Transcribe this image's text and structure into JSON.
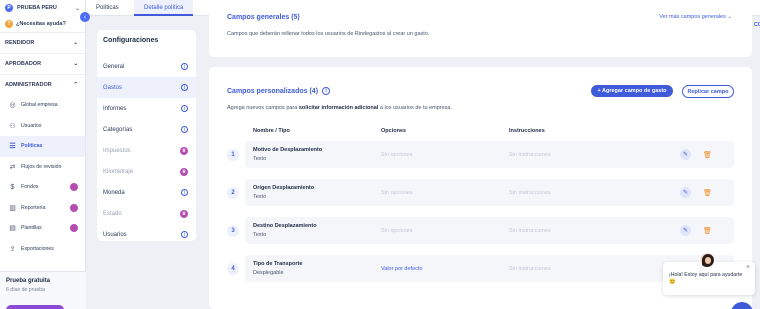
{
  "sidebar": {
    "org_name": "PRUEBA PERU",
    "org_initial": "P",
    "help_label": "¿Necesitas ayuda?",
    "sections": {
      "rendidor": "RENDIDOR",
      "aprobador": "APROBADOR",
      "administrador": "ADMINISTRADOR"
    },
    "items": [
      {
        "label": "Global empresa",
        "icon": "globe-icon"
      },
      {
        "label": "Usuarios",
        "icon": "users-icon"
      },
      {
        "label": "Políticas",
        "icon": "policy-icon"
      },
      {
        "label": "Flujos de revisión",
        "icon": "flow-icon"
      },
      {
        "label": "Fondos",
        "icon": "money-icon"
      },
      {
        "label": "Reportería",
        "icon": "chart-icon"
      },
      {
        "label": "Plantillas",
        "icon": "template-icon"
      },
      {
        "label": "Exportaciones",
        "icon": "export-icon"
      }
    ],
    "trial_title": "Prueba gratuita",
    "trial_days": "6 días de prueba"
  },
  "topbar": {
    "tabs": [
      "Políticas",
      "Detalle política"
    ]
  },
  "config": {
    "title": "Configuraciones",
    "items": [
      {
        "label": "General"
      },
      {
        "label": "Gastos"
      },
      {
        "label": "Informes"
      },
      {
        "label": "Categorías"
      },
      {
        "label": "Impuestos"
      },
      {
        "label": "Kilometraje"
      },
      {
        "label": "Moneda"
      },
      {
        "label": "Estado"
      },
      {
        "label": "Usuarios"
      }
    ]
  },
  "general_fields": {
    "title": "Campos generales (5)",
    "description": "Campos que deberán rellenar todos los usuarios de Rindegastos al crear un gasto.",
    "more_label": "Ver más campos generales"
  },
  "custom_fields": {
    "title": "Campos personalizados (4)",
    "desc_pre": "Agrega nuevos campos para ",
    "desc_bold": "solicitar información adicional",
    "desc_post": " a los usuarios de tu empresa.",
    "add_button": "+ Agregar campo de gasto",
    "replicate_button": "Replicar campo",
    "columns": {
      "name": "Nombre / Tipo",
      "options": "Opciones",
      "instructions": "Instrucciones"
    },
    "rows": [
      {
        "num": "1",
        "name": "Motivo de Desplazamiento",
        "type": "Texto",
        "options": "Sin opciones",
        "instructions": "Sin instrucciones"
      },
      {
        "num": "2",
        "name": "Origen Desplazamiento",
        "type": "Texto",
        "options": "Sin opciones",
        "instructions": "Sin instrucciones"
      },
      {
        "num": "3",
        "name": "Destino Desplazamiento",
        "type": "Texto",
        "options": "Sin opciones",
        "instructions": "Sin instrucciones"
      },
      {
        "num": "4",
        "name": "Tipo de Transporte",
        "type": "Desplegable",
        "options": "Valor por defecto",
        "instructions": "Sin instrucciones"
      }
    ]
  },
  "chat": {
    "message": "¡Hola! Estoy aquí para ayudarte 😊"
  },
  "edge_text": "CO",
  "colors": {
    "accent": "#3f5bd9",
    "premium": "#b44fb0",
    "delete": "#f08c1c"
  }
}
